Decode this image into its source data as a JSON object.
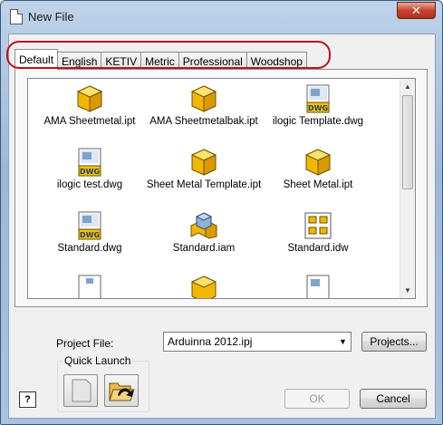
{
  "window": {
    "title": "New File",
    "close_label": "✕"
  },
  "tabs": [
    {
      "label": "Default",
      "active": true
    },
    {
      "label": "English",
      "active": false
    },
    {
      "label": "KETIV",
      "active": false
    },
    {
      "label": "Metric",
      "active": false
    },
    {
      "label": "Professional",
      "active": false
    },
    {
      "label": "Woodshop",
      "active": false
    }
  ],
  "templates": [
    {
      "label": "AMA Sheetmetal.ipt",
      "icon": "part-icon"
    },
    {
      "label": "AMA Sheetmetalbak.ipt",
      "icon": "part-icon"
    },
    {
      "label": "ilogic Template.dwg",
      "icon": "drawing-dwg-icon"
    },
    {
      "label": "ilogic test.dwg",
      "icon": "drawing-dwg-icon"
    },
    {
      "label": "Sheet Metal Template.ipt",
      "icon": "part-icon"
    },
    {
      "label": "Sheet Metal.ipt",
      "icon": "part-icon"
    },
    {
      "label": "Standard.dwg",
      "icon": "drawing-dwg-icon"
    },
    {
      "label": "Standard.iam",
      "icon": "assembly-icon"
    },
    {
      "label": "Standard.idw",
      "icon": "drawing-idw-icon"
    }
  ],
  "dwg_badge": "DWG",
  "project": {
    "label": "Project File:",
    "value": "Arduinna 2012.ipj",
    "projects_button": "Projects..."
  },
  "quick_launch": {
    "title": "Quick Launch"
  },
  "buttons": {
    "ok": "OK",
    "cancel": "Cancel",
    "help": "?"
  },
  "colors": {
    "highlight": "#c0101a",
    "part_yellow": "#ffcc22",
    "titlebar": "#a9c2e0"
  }
}
